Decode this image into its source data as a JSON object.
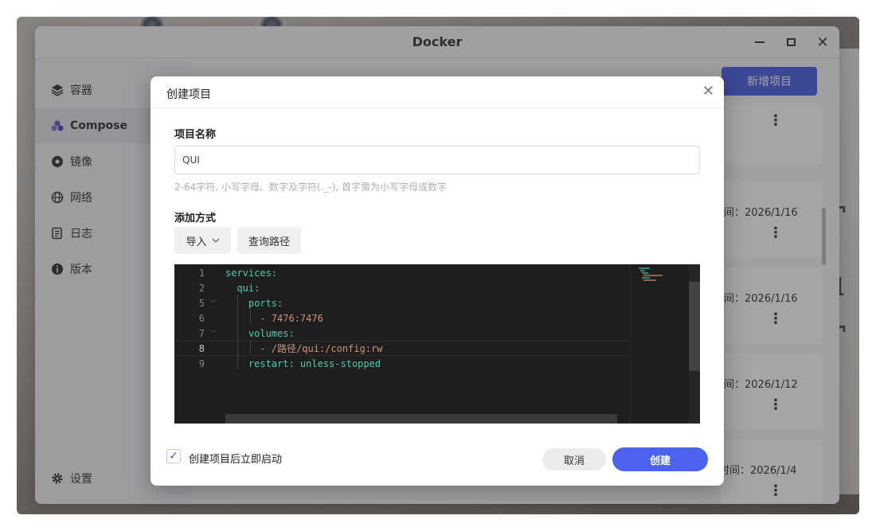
{
  "window": {
    "title": "Docker"
  },
  "sidebar": {
    "items": [
      {
        "label": "容器",
        "icon": "layers-icon"
      },
      {
        "label": "Compose",
        "icon": "compose-icon"
      },
      {
        "label": "镜像",
        "icon": "image-icon"
      },
      {
        "label": "网络",
        "icon": "globe-icon"
      },
      {
        "label": "日志",
        "icon": "log-icon"
      },
      {
        "label": "版本",
        "icon": "info-icon"
      }
    ],
    "settings_label": "设置"
  },
  "main": {
    "new_project_label": "新增项目",
    "project_cards": [
      {
        "time": ""
      },
      {
        "time": "间：2026/1/16"
      },
      {
        "time": "间：2026/1/16"
      },
      {
        "time": "间：2026/1/12"
      },
      {
        "time": "时间：2026/1/4"
      }
    ]
  },
  "dialog": {
    "title": "创建项目",
    "name_label": "项目名称",
    "name_value": "QUI",
    "name_hint": "2-64字符, 小写字母、数字及字符(._-), 首字需为小写字母或数字",
    "method_label": "添加方式",
    "import_label": "导入",
    "query_path_label": "查询路径",
    "editor_lines": [
      {
        "num": "1",
        "text": "services:"
      },
      {
        "num": "2",
        "text": "  qui:"
      },
      {
        "num": "5",
        "text": "    ports:"
      },
      {
        "num": "6",
        "text": "      - 7476:7476"
      },
      {
        "num": "7",
        "text": "    volumes:"
      },
      {
        "num": "8",
        "text": "      - /路径/qui:/config:rw"
      },
      {
        "num": "9",
        "text": "    restart: unless-stopped"
      }
    ],
    "autostart_label": "创建项目后立即启动",
    "autostart_checked": true,
    "cancel_label": "取消",
    "create_label": "创建"
  },
  "colors": {
    "accent": "#4a63f0",
    "editor_bg": "#1e1e1e",
    "yaml_key": "#4ec9b0",
    "yaml_value": "#ce9178"
  }
}
